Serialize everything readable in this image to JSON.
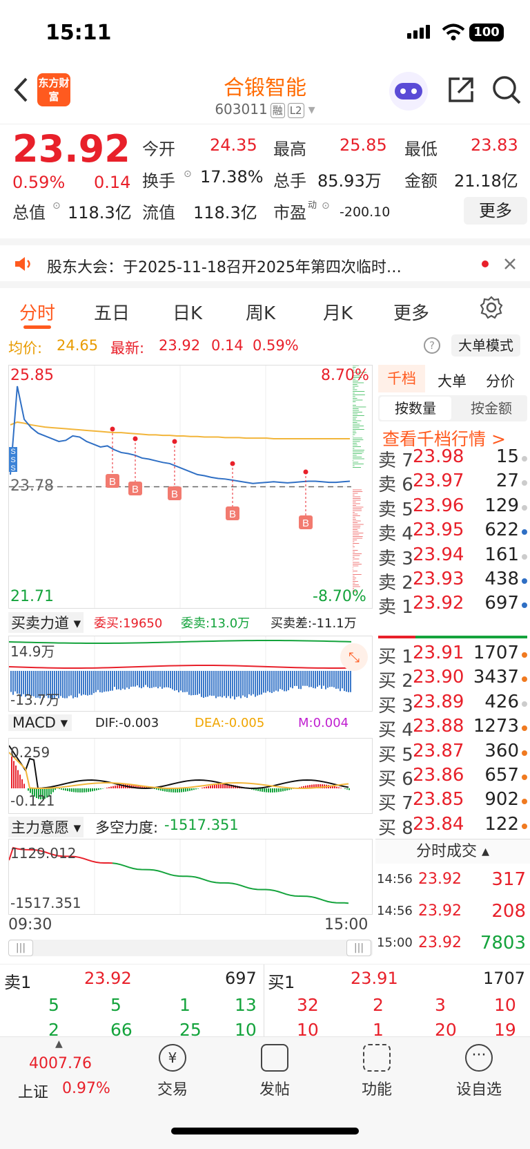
{
  "status": {
    "time": "15:11",
    "battery": "100"
  },
  "header": {
    "logo": "东方财富",
    "title": "合锻智能",
    "code": "603011",
    "tags": [
      "融",
      "L2"
    ]
  },
  "quote": {
    "price": "23.92",
    "pct": "0.59%",
    "change": "0.14",
    "rows": [
      [
        {
          "l": "今开",
          "v": "24.35",
          "c": "red"
        },
        {
          "l": "最高",
          "v": "25.85",
          "c": "red"
        },
        {
          "l": "最低",
          "v": "23.83",
          "c": "red"
        }
      ],
      [
        {
          "l": "换手",
          "v": "17.38%",
          "c": "dark"
        },
        {
          "l": "总手",
          "v": "85.93万",
          "c": "dark"
        },
        {
          "l": "金额",
          "v": "21.18亿",
          "c": "dark"
        }
      ]
    ],
    "total_label": "总值",
    "total_val": "118.3亿",
    "float_label": "流值",
    "float_val": "118.3亿",
    "pe_label": "市盈",
    "pe_sup": "动",
    "pe_val": "-200.10",
    "more": "更多"
  },
  "notice": {
    "text": "股东大会：于2025-11-18召开2025年第四次临时…"
  },
  "tabs": [
    "分时",
    "五日",
    "日K",
    "周K",
    "月K",
    "更多"
  ],
  "infobar": {
    "avg_label": "均价:",
    "avg": "24.65",
    "last_label": "最新:",
    "last": "23.92",
    "chg": "0.14",
    "pct": "0.59%",
    "mode": "大单模式"
  },
  "chart": {
    "high": "25.85",
    "low": "21.71",
    "mid": "23.78",
    "up_pct": "8.70%",
    "down_pct": "-8.70%",
    "price_series": [
      24.0,
      25.6,
      25.0,
      24.85,
      24.75,
      24.7,
      24.65,
      24.6,
      24.62,
      24.7,
      24.68,
      24.6,
      24.55,
      24.5,
      24.52,
      24.45,
      24.4,
      24.38,
      24.35,
      24.3,
      24.28,
      24.25,
      24.22,
      24.2,
      24.15,
      24.1,
      24.05,
      24.0,
      23.98,
      23.95,
      23.93,
      23.92,
      23.9,
      23.88,
      23.86,
      23.84,
      23.85,
      23.86,
      23.87,
      23.86,
      23.85,
      23.86,
      23.87,
      23.88,
      23.88,
      23.87,
      23.86,
      23.86,
      23.87,
      23.88
    ],
    "avg_series": [
      24.9,
      24.95,
      24.93,
      24.9,
      24.88,
      24.86,
      24.85,
      24.84,
      24.83,
      24.82,
      24.81,
      24.8,
      24.79,
      24.78,
      24.77,
      24.76,
      24.76,
      24.75,
      24.74,
      24.73,
      24.72,
      24.72,
      24.71,
      24.71,
      24.7,
      24.7,
      24.69,
      24.69,
      24.68,
      24.68,
      24.68,
      24.67,
      24.67,
      24.67,
      24.66,
      24.66,
      24.66,
      24.66,
      24.65,
      24.65,
      24.65,
      24.65,
      24.65,
      24.65,
      24.65,
      24.65,
      24.65,
      24.65,
      24.65,
      24.65
    ],
    "b_markers": [
      "B",
      "B",
      "B",
      "B",
      "B"
    ],
    "s_markers": [
      "S",
      "S",
      "S"
    ]
  },
  "buysell": {
    "label": "买卖力道",
    "wei_buy": "委买:19650",
    "wei_sell": "委卖:13.0万",
    "diff": "买卖差:-11.1万",
    "top": "14.9万",
    "bottom": "-13.7万"
  },
  "macd": {
    "label": "MACD",
    "dif": "DIF:-0.003",
    "dea": "DEA:-0.005",
    "m": "M:0.004",
    "top": "0.259",
    "bottom": "-0.121"
  },
  "main": {
    "label": "主力意愿",
    "force": "多空力度:",
    "force_val": "-1517.351",
    "top": "1129.012",
    "bottom": "-1517.351",
    "t_start": "09:30",
    "t_end": "15:00"
  },
  "side": {
    "tab1": "千档",
    "tab2": "大单",
    "tab3": "分价",
    "sub1": "按数量",
    "sub2": "按金额",
    "link": "查看千档行情 >",
    "sells": [
      {
        "l": "卖 7",
        "p": "23.98",
        "v": "15",
        "d": "gray"
      },
      {
        "l": "卖 6",
        "p": "23.97",
        "v": "27",
        "d": "gray"
      },
      {
        "l": "卖 5",
        "p": "23.96",
        "v": "129",
        "d": "gray"
      },
      {
        "l": "卖 4",
        "p": "23.95",
        "v": "622",
        "d": "blue"
      },
      {
        "l": "卖 3",
        "p": "23.94",
        "v": "161",
        "d": "gray"
      },
      {
        "l": "卖 2",
        "p": "23.93",
        "v": "438",
        "d": "blue"
      },
      {
        "l": "卖 1",
        "p": "23.92",
        "v": "697",
        "d": "blue"
      }
    ],
    "buys": [
      {
        "l": "买 1",
        "p": "23.91",
        "v": "1707",
        "d": "orange"
      },
      {
        "l": "买 2",
        "p": "23.90",
        "v": "3437",
        "d": "orange"
      },
      {
        "l": "买 3",
        "p": "23.89",
        "v": "426",
        "d": "gray"
      },
      {
        "l": "买 4",
        "p": "23.88",
        "v": "1273",
        "d": "orange"
      },
      {
        "l": "买 5",
        "p": "23.87",
        "v": "360",
        "d": "orange"
      },
      {
        "l": "买 6",
        "p": "23.86",
        "v": "657",
        "d": "orange"
      },
      {
        "l": "买 7",
        "p": "23.85",
        "v": "902",
        "d": "orange"
      },
      {
        "l": "买 8",
        "p": "23.84",
        "v": "122",
        "d": "orange"
      }
    ],
    "ticks_title": "分时成交",
    "ticks": [
      {
        "t": "14:56",
        "p": "23.92",
        "v": "317",
        "c": "red"
      },
      {
        "t": "14:56",
        "p": "23.92",
        "v": "208",
        "c": "red"
      },
      {
        "t": "15:00",
        "p": "23.92",
        "v": "7803",
        "c": "green"
      }
    ]
  },
  "bottom_ob": {
    "sell_label": "卖1",
    "sell_price": "23.92",
    "sell_vol": "697",
    "buy_label": "买1",
    "buy_price": "23.91",
    "buy_vol": "1707",
    "left_rows": [
      [
        "5",
        "5",
        "1",
        "13"
      ],
      [
        "2",
        "66",
        "25",
        "10"
      ]
    ],
    "right_rows": [
      [
        "32",
        "2",
        "3",
        "10"
      ],
      [
        "10",
        "1",
        "20",
        "19"
      ]
    ]
  },
  "nav": {
    "index_val": "4007.76",
    "index_name": "上证",
    "index_pct": "0.97%",
    "items": [
      "交易",
      "发帖",
      "功能",
      "设自选"
    ]
  }
}
